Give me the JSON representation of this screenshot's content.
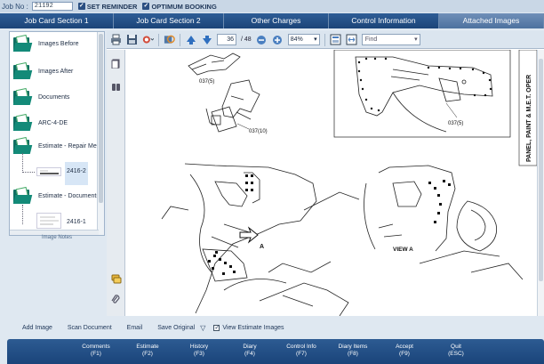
{
  "topbar": {
    "job_label": "Job No :",
    "job_value": "21192",
    "set_reminder": "SET REMINDER",
    "optimum_booking": "OPTIMUM BOOKING"
  },
  "tabs": [
    {
      "label": "Job Card Section 1"
    },
    {
      "label": "Job Card Section 2"
    },
    {
      "label": "Other Charges"
    },
    {
      "label": "Control Information"
    },
    {
      "label": "Attached Images"
    }
  ],
  "tree": {
    "items": [
      {
        "label": "Images Before"
      },
      {
        "label": "Images After"
      },
      {
        "label": "Documents"
      },
      {
        "label": "ARC-4-DE"
      },
      {
        "label": "Estimate - Repair Met"
      },
      {
        "label": "Estimate - Documents"
      }
    ],
    "children": [
      {
        "label": "2416-2"
      },
      {
        "label": "2416-1"
      }
    ],
    "notes_label": "Image Notes"
  },
  "viewer": {
    "page_current": "36",
    "page_total": "/ 48",
    "zoom": "84%",
    "find_placeholder": "Find",
    "doc": {
      "callout_1": "037(5)",
      "callout_2": "037(10)",
      "callout_3": "037(5)",
      "label_a": "A",
      "view_a": "VIEW A",
      "side_title": "PANEL, PAINT & M.E.T. OPER"
    }
  },
  "actions": {
    "add_image": "Add Image",
    "scan_document": "Scan Document",
    "email": "Email",
    "save_original": "Save Original",
    "view_estimate": "View Estimate Images",
    "view_estimate_checked": true
  },
  "fkeys": [
    {
      "label": "Comments",
      "key": "(F1)"
    },
    {
      "label": "Estimate",
      "key": "(F2)"
    },
    {
      "label": "History",
      "key": "(F3)"
    },
    {
      "label": "Diary",
      "key": "(F4)"
    },
    {
      "label": "Control Info",
      "key": "(F7)"
    },
    {
      "label": "Diary Items",
      "key": "(F8)"
    },
    {
      "label": "Accept",
      "key": "(F9)"
    },
    {
      "label": "Quit",
      "key": "(ESC)"
    }
  ],
  "colors": {
    "tab_bar": "#153967",
    "tab_active": "#5f81ad",
    "folder": "#138a78",
    "fkey_bar": "#1f4a80"
  }
}
